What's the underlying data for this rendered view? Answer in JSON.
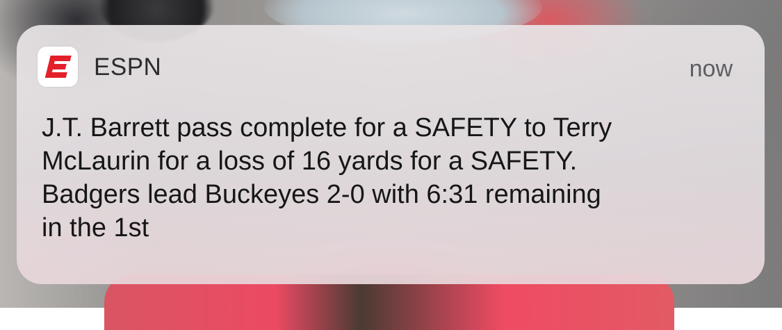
{
  "notification": {
    "app_icon": "espn-logo-icon",
    "app_name": "ESPN",
    "timestamp": "now",
    "message_lines": [
      "J.T. Barrett pass complete for a SAFETY to Terry",
      "McLaurin for a loss of 16 yards for a SAFETY.",
      "Badgers lead Buckeyes 2-0 with 6:31 remaining",
      "in the 1st"
    ]
  },
  "colors": {
    "brand_red": "#e3202a",
    "card_background": "#e6e1e3",
    "text_primary": "#161616",
    "text_secondary": "#5e5e62"
  }
}
